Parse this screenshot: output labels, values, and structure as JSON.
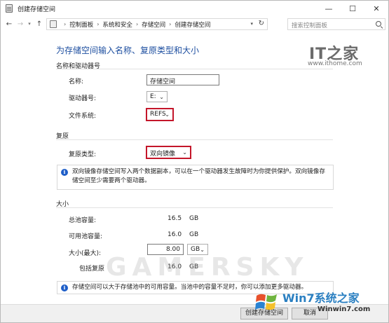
{
  "window": {
    "title": "创建存储空间",
    "controls": {
      "minimize": "—",
      "maximize": "☐",
      "close": "✕"
    }
  },
  "address_bar": {
    "breadcrumbs": [
      "控制面板",
      "系统和安全",
      "存储空间",
      "创建存储空间"
    ],
    "search_placeholder": "搜索控制面板"
  },
  "page": {
    "title": "为存储空间输入名称、复原类型和大小"
  },
  "name_section": {
    "heading": "名称和驱动器号",
    "name_label": "名称:",
    "name_value": "存储空间",
    "drive_label": "驱动器号:",
    "drive_value": "E:",
    "fs_label": "文件系统:",
    "fs_value": "REFS"
  },
  "resiliency_section": {
    "heading": "复原",
    "type_label": "复原类型:",
    "type_value": "双向镜像",
    "info": "双向镜像存储空间写入两个数据副本，可以在一个驱动器发生故障时为你提供保护。双向镜像存储空间至少需要两个驱动器。"
  },
  "size_section": {
    "heading": "大小",
    "total_label": "总池容量:",
    "total_value": "16.5",
    "total_unit": "GB",
    "avail_label": "可用池容量:",
    "avail_value": "16.0",
    "avail_unit": "GB",
    "max_label": "大小(最大):",
    "max_value": "8.00",
    "max_unit": "GB",
    "incl_label": "包括复原",
    "incl_value": "16.0",
    "incl_unit": "GB",
    "info": "存储空间可以大于存储池中的可用容量。当池中的容量不足时，你可以添加更多驱动器。"
  },
  "footer": {
    "create_button": "创建存储空间",
    "cancel_button": "取消"
  },
  "overlays": {
    "logo": "IT之家",
    "logo_url": "www.ithome.com",
    "watermark": "GAMERSKY",
    "win7_brand": "Win7系统之家",
    "win7_site": "Winwin7.com"
  },
  "colors": {
    "accent_title": "#1e4fa0",
    "highlight_border": "#c4162a",
    "info_icon": "#1e5ec8"
  }
}
